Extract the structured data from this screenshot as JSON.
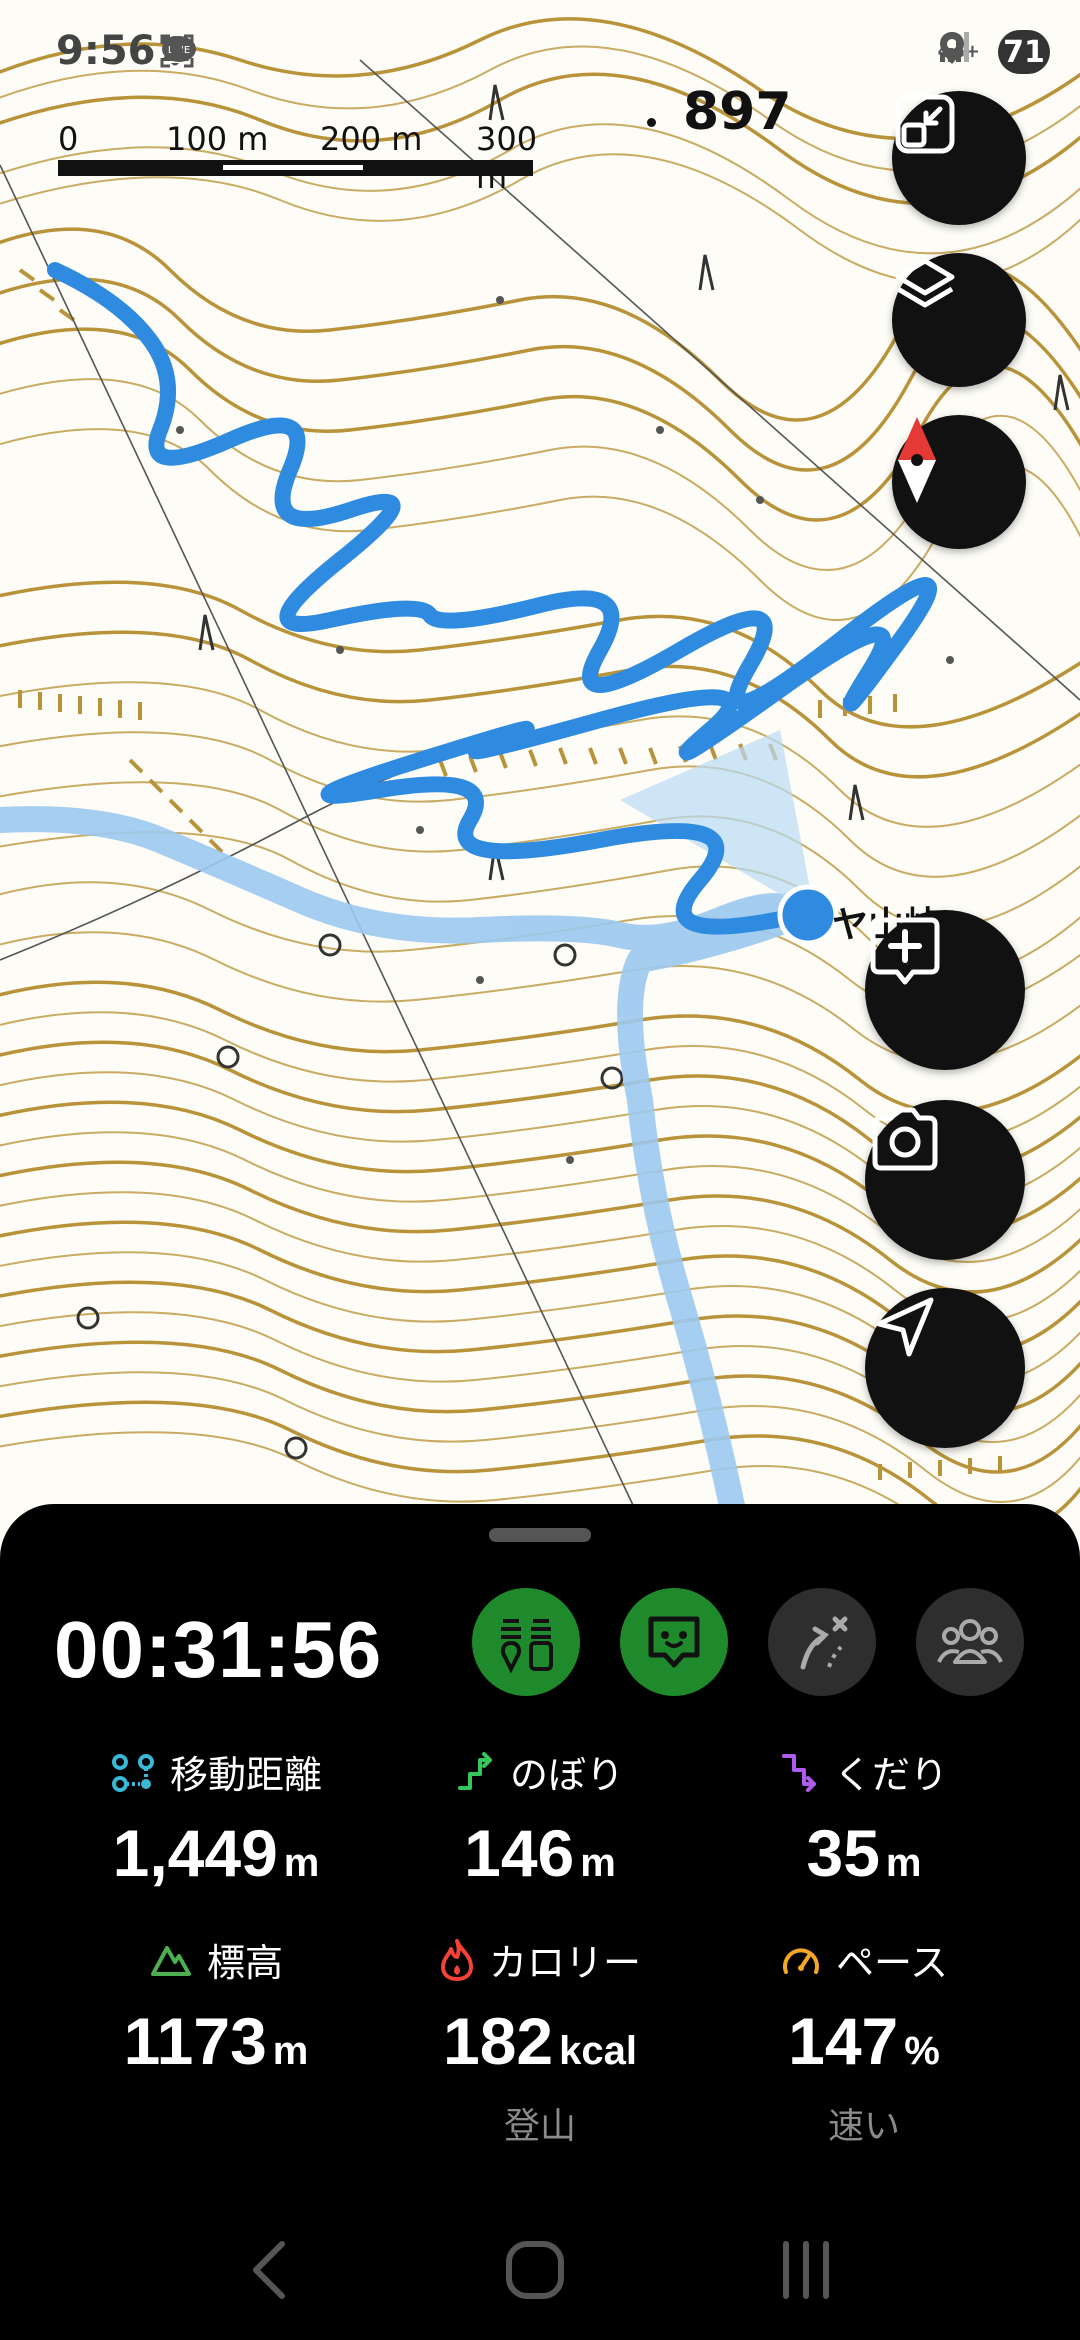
{
  "status_bar": {
    "time": "9:56",
    "network": "4G+",
    "battery": "71"
  },
  "map": {
    "scale_labels": [
      "0",
      "100 m",
      "200 m",
      "300 m"
    ],
    "elevation_point": "897",
    "place_label": "ヤ山峠",
    "colors": {
      "contour": "#b8933a",
      "track": "#2f8be0",
      "planned_route": "#9cc9ef",
      "background": "#fdfcf6"
    }
  },
  "map_buttons": [
    {
      "name": "fit-screen-button",
      "icon": "fit-screen-icon"
    },
    {
      "name": "layers-button",
      "icon": "layers-icon"
    },
    {
      "name": "compass-button",
      "icon": "compass-icon"
    },
    {
      "name": "add-memo-button",
      "icon": "add-memo-icon"
    },
    {
      "name": "camera-button",
      "icon": "camera-icon"
    },
    {
      "name": "current-location-button",
      "icon": "navigation-arrow-icon"
    }
  ],
  "panel": {
    "timer": "00:31:56",
    "stats": [
      {
        "label": "移動距離",
        "value": "1,449",
        "unit": "m",
        "sub": "",
        "icon": "distance-icon",
        "color": "#3ab8d8"
      },
      {
        "label": "のぼり",
        "value": "146",
        "unit": "m",
        "sub": "",
        "icon": "ascent-icon",
        "color": "#34c759"
      },
      {
        "label": "くだり",
        "value": "35",
        "unit": "m",
        "sub": "",
        "icon": "descent-icon",
        "color": "#b15cf0"
      },
      {
        "label": "標高",
        "value": "1173",
        "unit": "m",
        "sub": "",
        "icon": "mountain-icon",
        "color": "#4caf50"
      },
      {
        "label": "カロリー",
        "value": "182",
        "unit": "kcal",
        "sub": "登山",
        "icon": "flame-icon",
        "color": "#f44336"
      },
      {
        "label": "ペース",
        "value": "147",
        "unit": "%",
        "sub": "速い",
        "icon": "speedometer-icon",
        "color": "#f5a623"
      }
    ]
  }
}
